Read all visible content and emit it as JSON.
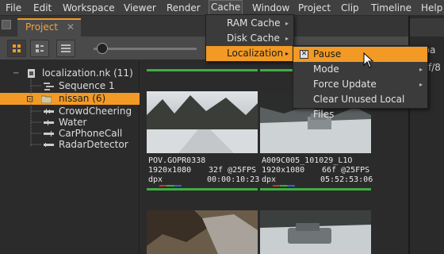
{
  "menubar": {
    "items": [
      "File",
      "Edit",
      "Workspace",
      "Viewer",
      "Render",
      "Cache",
      "Window",
      "Project",
      "Clip",
      "Timeline",
      "Help"
    ],
    "open_item": "Cache"
  },
  "tabs": {
    "project_label": "Project",
    "close_glyph": "✕"
  },
  "right_pane": {
    "text1": "aba",
    "text2": "f/8"
  },
  "tree": {
    "root": "localization.nk (11)",
    "items": [
      "Sequence 1",
      "nissan (6)",
      "CrowdCheering",
      "Water",
      "CarPhoneCall",
      "RadarDetector"
    ],
    "selected": "nissan (6)"
  },
  "clips": [
    {
      "name": "POV.GOPR0338",
      "res": "1920x1080",
      "fps": "32f @25FPS",
      "format": "dpx",
      "timecode": "00:00:10:23"
    },
    {
      "name": "A009C005_101029_L1O",
      "res": "1920x1080",
      "fps": "66f @25FPS",
      "format": "dpx",
      "timecode": "05:52:53:06"
    }
  ],
  "cache_menu": {
    "items": [
      "RAM Cache",
      "Disk Cache",
      "Localization"
    ],
    "highlighted": "Localization"
  },
  "localization_menu": {
    "items": [
      "Pause",
      "Mode",
      "Force Update",
      "Clear Unused Local Files"
    ],
    "highlighted": "Pause",
    "pause_icon": "pause-toggle-icon"
  },
  "colors": {
    "accent": "#f29a25",
    "cached_bar": "#3fae43"
  }
}
